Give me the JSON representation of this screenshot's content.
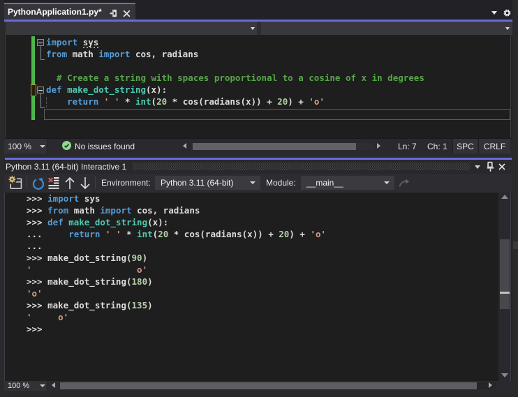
{
  "window": {
    "accent_color": "#6A6ADC",
    "background": "#1E1E1E"
  },
  "tab_strip": {
    "tab_label": "PythonApplication1.py*",
    "pin_icon": "pin",
    "close_icon": "close",
    "chevron_icon": "chevron-down",
    "gear_icon": "gear"
  },
  "nav_bar": {
    "left_dropdown_value": "",
    "right_dropdown_value": ""
  },
  "editor": {
    "lines": [
      [
        [
          "import",
          "kw"
        ],
        [
          " ",
          "txt"
        ],
        [
          "sys",
          "txt"
        ]
      ],
      [
        [
          "from",
          "kw"
        ],
        [
          " math ",
          "txt"
        ],
        [
          "import",
          "kw"
        ],
        [
          " cos, radians",
          "txt"
        ]
      ],
      [],
      [
        [
          "  # Create a string with spaces proportional to a cosine of x in degrees",
          "com"
        ]
      ],
      [
        [
          "def",
          "kw"
        ],
        [
          " ",
          "txt"
        ],
        [
          "make_dot_string",
          "fn"
        ],
        [
          "(x):",
          "txt"
        ]
      ],
      [
        [
          "    ",
          "txt"
        ],
        [
          "return",
          "kw"
        ],
        [
          " ",
          "txt"
        ],
        [
          "' '",
          "str"
        ],
        [
          " * ",
          "txt"
        ],
        [
          "int",
          "fn"
        ],
        [
          "(",
          "txt"
        ],
        [
          "20",
          "num"
        ],
        [
          " * cos(radians(x)) + ",
          "txt"
        ],
        [
          "20",
          "num"
        ],
        [
          ") + ",
          "txt"
        ],
        [
          "'o'",
          "str"
        ]
      ],
      []
    ]
  },
  "editor_status": {
    "zoom": "100 %",
    "message": "No issues found",
    "line": "Ln: 7",
    "column": "Ch: 1",
    "spaces": "SPC",
    "line_ending": "CRLF"
  },
  "repl": {
    "title": "Python 3.11 (64-bit) Interactive 1",
    "toolbar": {
      "environment_label": "Environment:",
      "environment_value": "Python 3.11 (64-bit)",
      "module_label": "Module:",
      "module_value": "__main__"
    },
    "lines": [
      [
        [
          ">>> ",
          "txt"
        ],
        [
          "import",
          "kw"
        ],
        [
          " sys",
          "txt"
        ]
      ],
      [
        [
          ">>> ",
          "txt"
        ],
        [
          "from",
          "kw"
        ],
        [
          " math ",
          "txt"
        ],
        [
          "import",
          "kw"
        ],
        [
          " cos, radians",
          "txt"
        ]
      ],
      [
        [
          ">>> ",
          "txt"
        ],
        [
          "def",
          "kw"
        ],
        [
          " ",
          "txt"
        ],
        [
          "make_dot_string",
          "fn"
        ],
        [
          "(x):",
          "txt"
        ]
      ],
      [
        [
          "...     ",
          "txt"
        ],
        [
          "return",
          "kw"
        ],
        [
          " ",
          "txt"
        ],
        [
          "' '",
          "str"
        ],
        [
          " * ",
          "txt"
        ],
        [
          "int",
          "fn"
        ],
        [
          "(",
          "txt"
        ],
        [
          "20",
          "num"
        ],
        [
          " * cos(radians(x)) + ",
          "txt"
        ],
        [
          "20",
          "num"
        ],
        [
          ") + ",
          "txt"
        ],
        [
          "'o'",
          "str"
        ]
      ],
      [
        [
          "...",
          "txt"
        ]
      ],
      [
        [
          ">>> make_dot_string(",
          "txt"
        ],
        [
          "90",
          "num"
        ],
        [
          ")",
          "txt"
        ]
      ],
      [
        [
          "'                    o'",
          "str"
        ]
      ],
      [
        [
          ">>> make_dot_string(",
          "txt"
        ],
        [
          "180",
          "num"
        ],
        [
          ")",
          "txt"
        ]
      ],
      [
        [
          "'o'",
          "str"
        ]
      ],
      [
        [
          ">>> make_dot_string(",
          "txt"
        ],
        [
          "135",
          "num"
        ],
        [
          ")",
          "txt"
        ]
      ],
      [
        [
          "'     o'",
          "str"
        ]
      ],
      [
        [
          ">>>",
          "txt"
        ]
      ]
    ],
    "zoom": "100 %"
  }
}
